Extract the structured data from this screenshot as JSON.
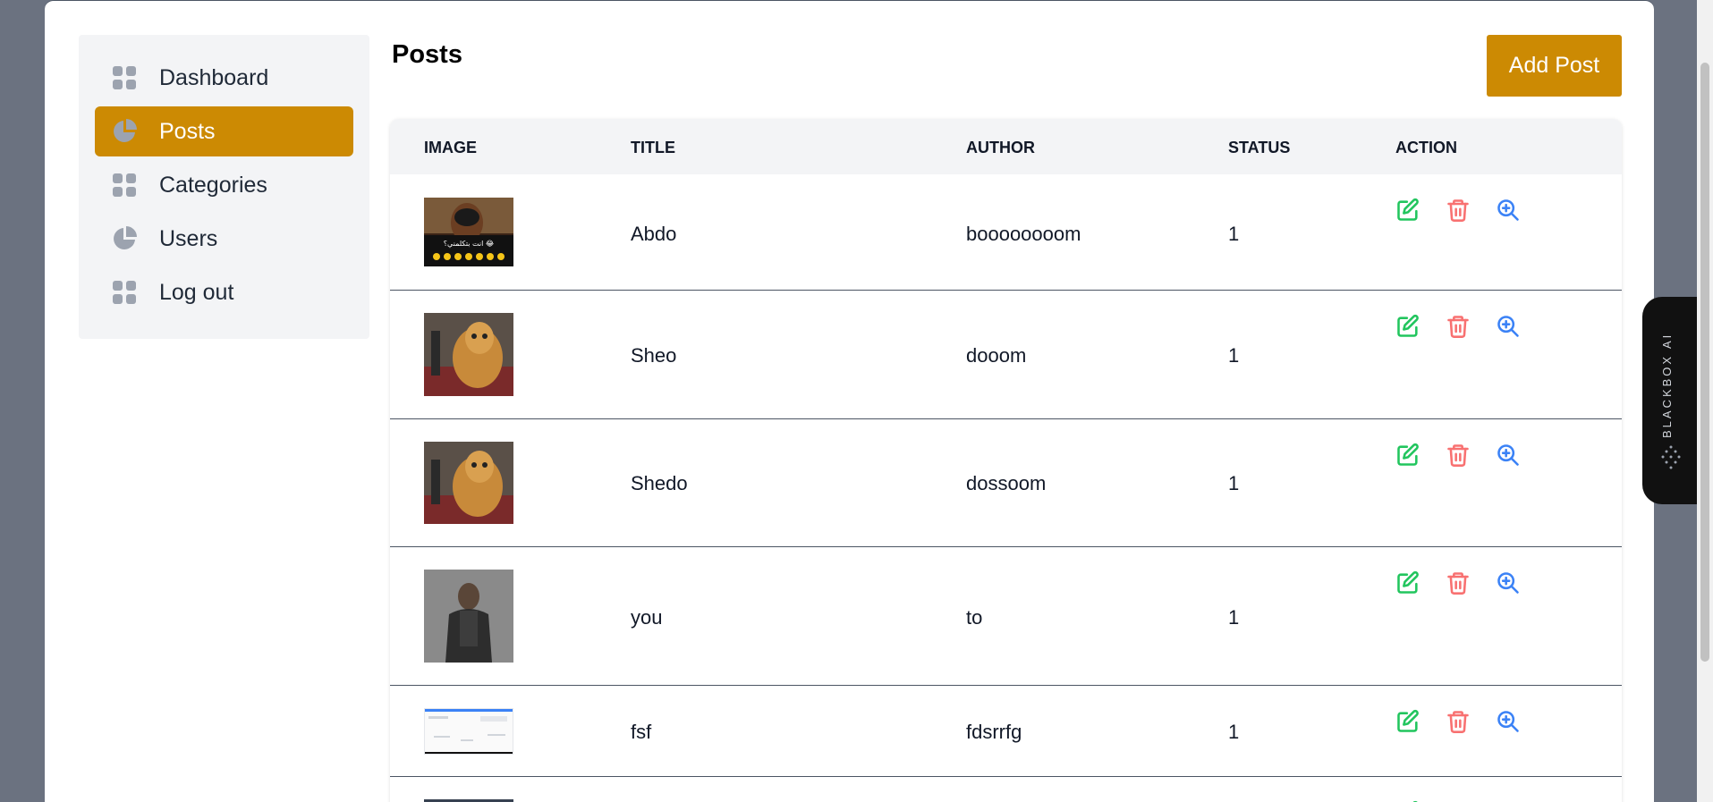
{
  "sidebar": {
    "items": [
      {
        "label": "Dashboard",
        "icon": "grid-icon"
      },
      {
        "label": "Posts",
        "icon": "pie-chart-icon"
      },
      {
        "label": "Categories",
        "icon": "grid-icon"
      },
      {
        "label": "Users",
        "icon": "pie-chart-icon"
      },
      {
        "label": "Log out",
        "icon": "grid-icon"
      }
    ]
  },
  "main": {
    "title": "Posts",
    "add_button": "Add Post"
  },
  "table": {
    "headers": [
      "IMAGE",
      "TITLE",
      "AUTHOR",
      "STATUS",
      "ACTION"
    ],
    "rows": [
      {
        "title": "Abdo",
        "author": "boooooooom",
        "status": "1",
        "image_caption": "انت بتكلمني؟ 😂"
      },
      {
        "title": "Sheo",
        "author": "dooom",
        "status": "1"
      },
      {
        "title": "Shedo",
        "author": "dossoom",
        "status": "1"
      },
      {
        "title": "you",
        "author": "to",
        "status": "1"
      },
      {
        "title": "fsf",
        "author": "fdsrrfg",
        "status": "1"
      }
    ]
  },
  "blackbox": {
    "label": "BLACKBOX AI"
  },
  "colors": {
    "accent": "#cc8a03",
    "edit": "#22c55e",
    "delete": "#f87171",
    "view": "#3b82f6"
  }
}
